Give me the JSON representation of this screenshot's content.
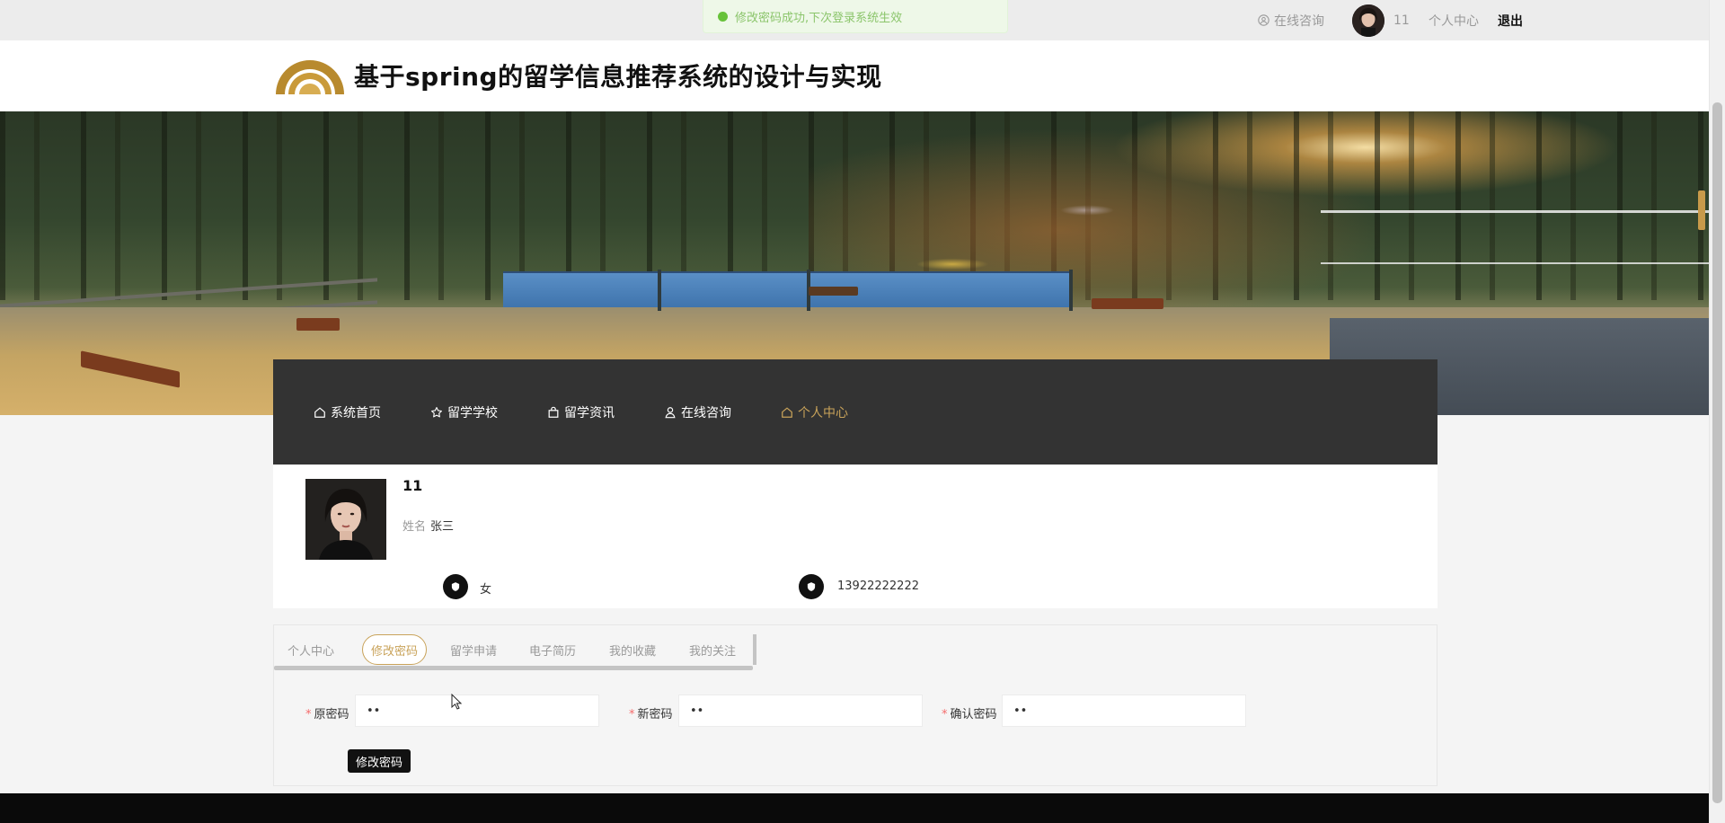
{
  "toast": {
    "message": "修改密码成功,下次登录系统生效",
    "color": "#67c23a"
  },
  "topbar": {
    "consult_label": "在线咨询",
    "username": "11",
    "center_label": "个人中心",
    "logout_label": "退出"
  },
  "site": {
    "title": "基于spring的留学信息推荐系统的设计与实现",
    "accent": "#c9a35a"
  },
  "nav": {
    "items": [
      {
        "label": "系统首页",
        "icon": "home-icon"
      },
      {
        "label": "留学学校",
        "icon": "star-icon"
      },
      {
        "label": "留学资讯",
        "icon": "bag-icon"
      },
      {
        "label": "在线咨询",
        "icon": "user-icon"
      },
      {
        "label": "个人中心",
        "icon": "home-icon",
        "active": true
      }
    ]
  },
  "profile": {
    "username": "11",
    "name_label": "姓名",
    "name_value": "张三",
    "gender": "女",
    "phone": "13922222222"
  },
  "tabs": [
    {
      "label": "个人中心"
    },
    {
      "label": "修改密码",
      "active": true
    },
    {
      "label": "留学申请"
    },
    {
      "label": "电子简历"
    },
    {
      "label": "我的收藏"
    },
    {
      "label": "我的关注"
    }
  ],
  "form": {
    "old_password": {
      "label": "原密码",
      "value": "••"
    },
    "new_password": {
      "label": "新密码",
      "value": "••"
    },
    "confirm_password": {
      "label": "确认密码",
      "value": "••"
    },
    "submit_label": "修改密码"
  }
}
